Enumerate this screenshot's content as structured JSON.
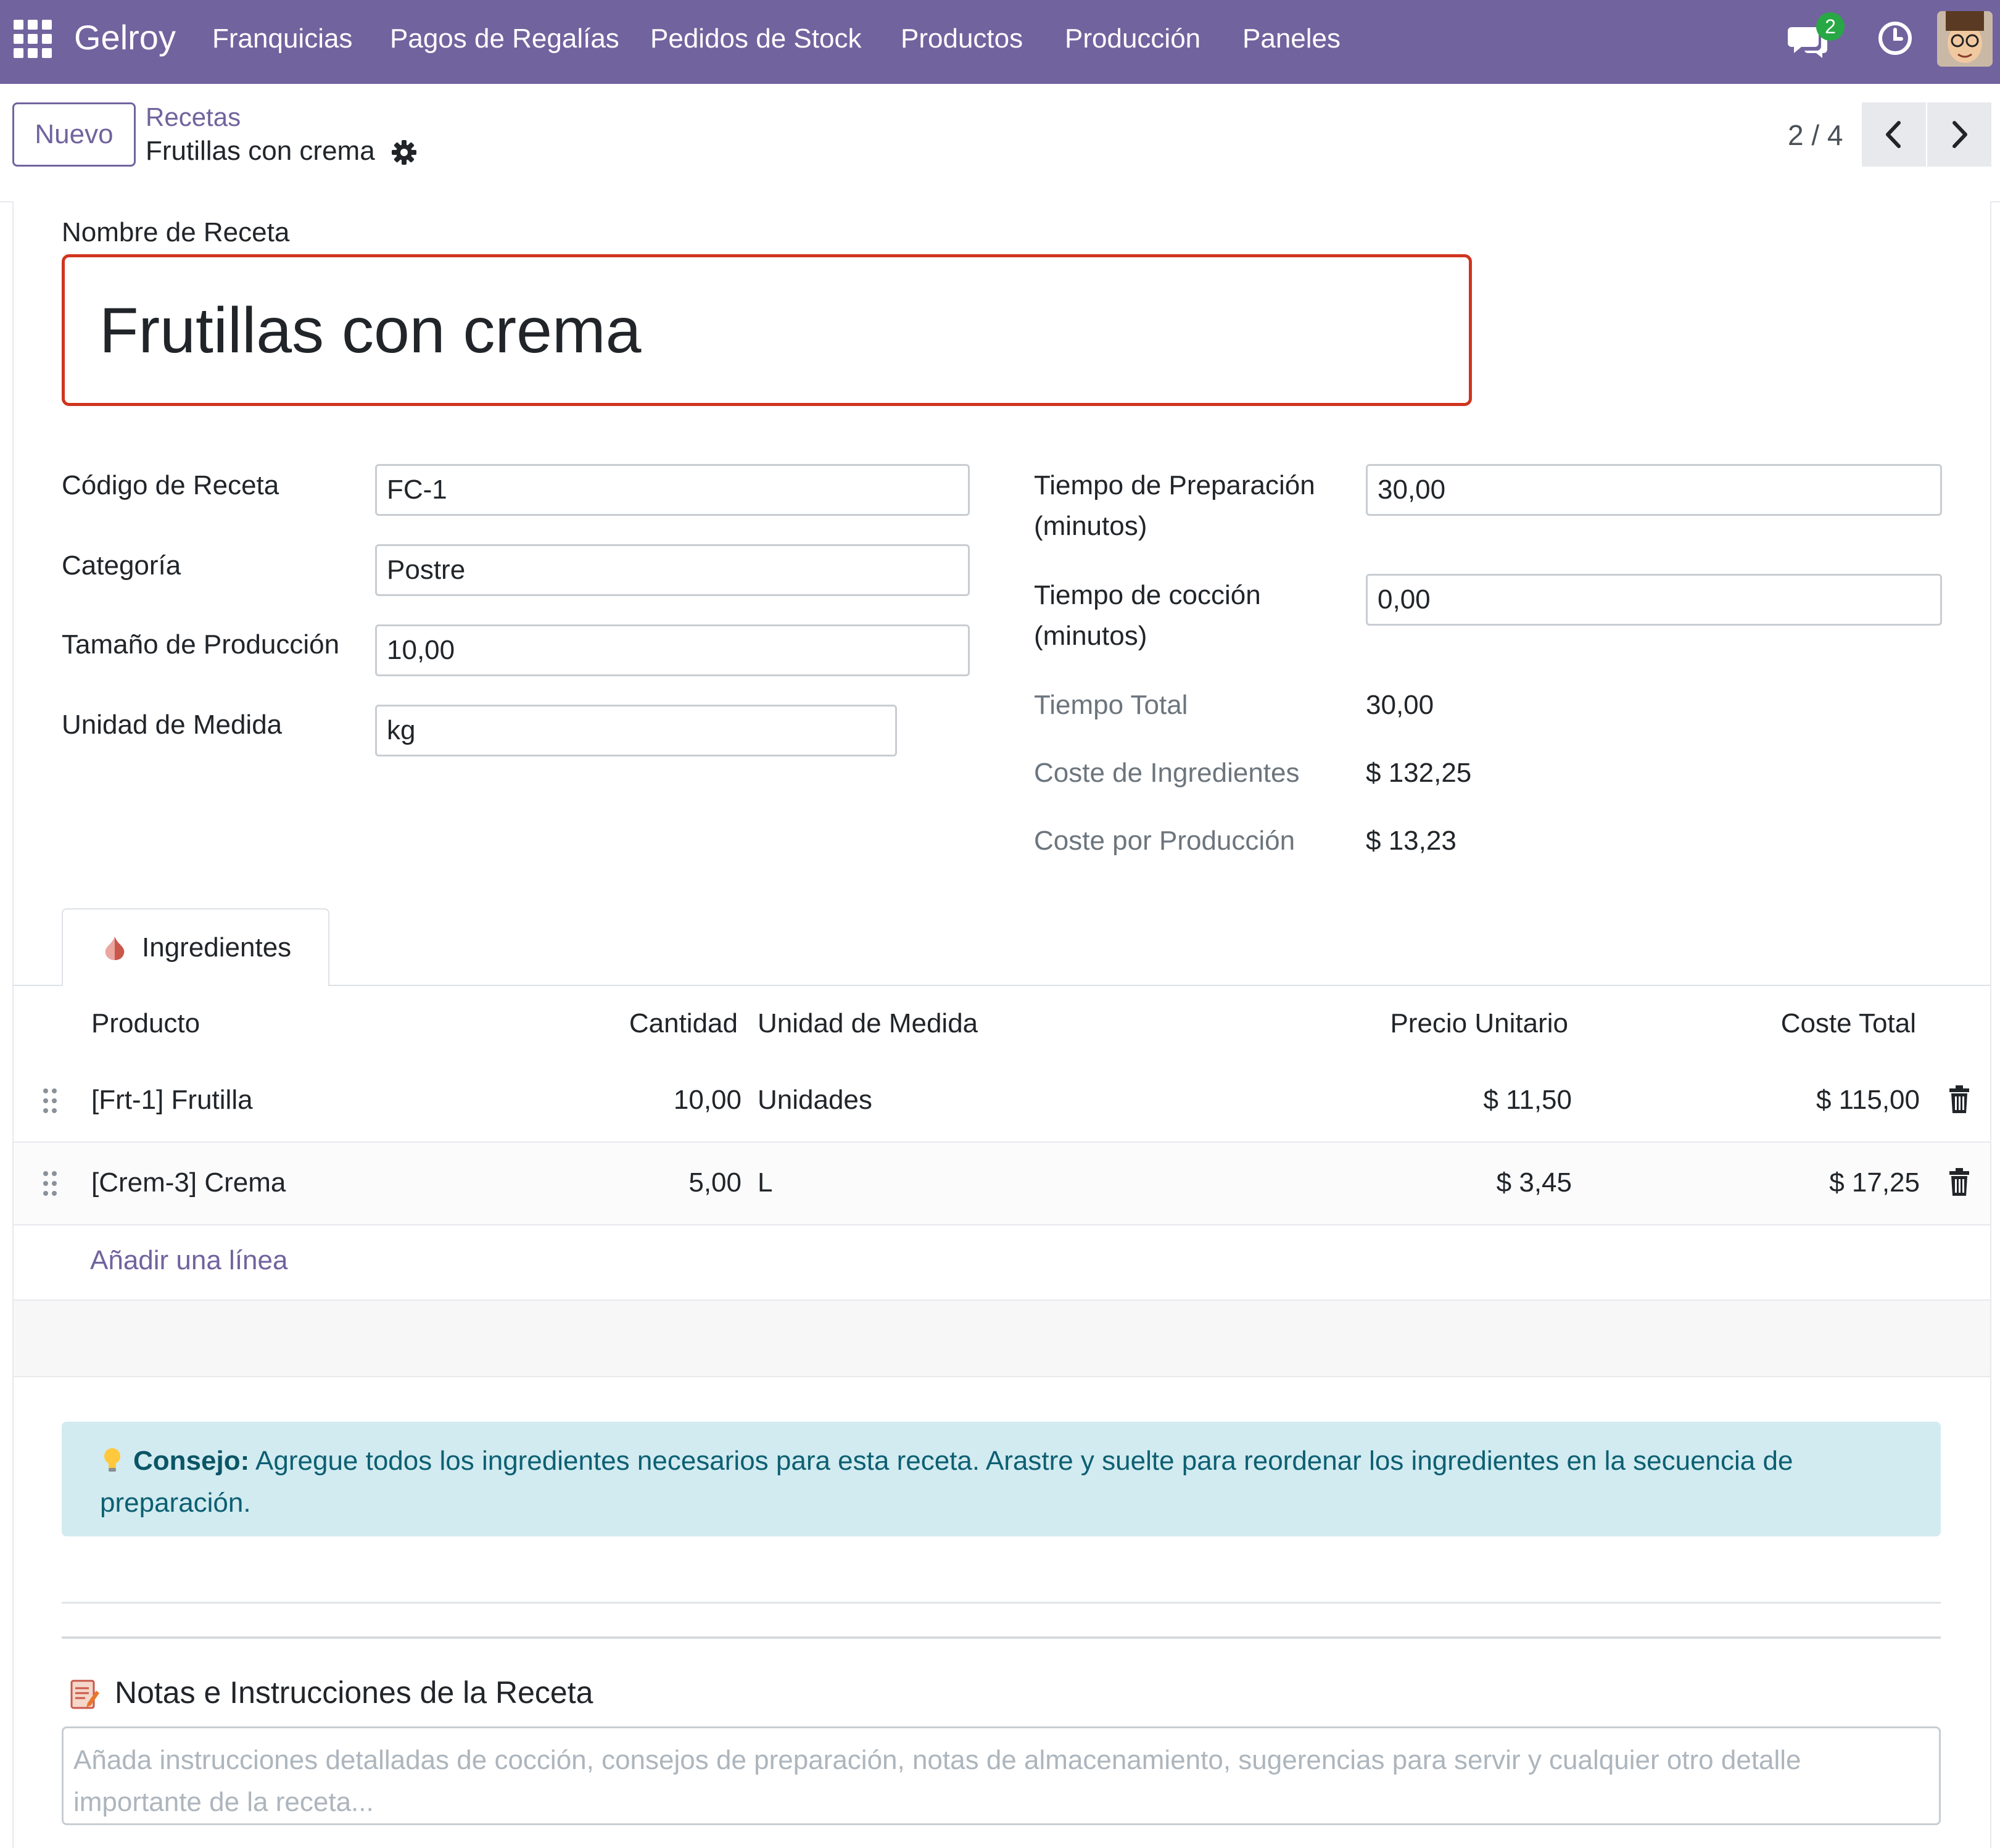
{
  "app": {
    "brand": "Gelroy",
    "menu": [
      "Franquicias",
      "Pagos de Regalías",
      "Pedidos de Stock",
      "Productos",
      "Producción",
      "Paneles"
    ],
    "chat_badge": "2",
    "accent_color": "#71639e"
  },
  "control": {
    "new_button": "Nuevo",
    "breadcrumb_parent": "Recetas",
    "breadcrumb_current": "Frutillas con crema",
    "pager": "2 / 4"
  },
  "form": {
    "name_label": "Nombre de Receta",
    "name_value": "Frutillas con crema",
    "left": [
      {
        "label": "Código de Receta",
        "value": "FC-1"
      },
      {
        "label": "Categoría",
        "value": "Postre"
      },
      {
        "label": "Tamaño de Producción",
        "value": "10,00"
      },
      {
        "label": "Unidad de Medida",
        "value": "kg"
      }
    ],
    "right": {
      "prep_label_1": "Tiempo de Preparación",
      "prep_label_2": "(minutos)",
      "prep_value": "30,00",
      "cook_label_1": "Tiempo de cocción",
      "cook_label_2": "(minutos)",
      "cook_value": "0,00",
      "total_label": "Tiempo Total",
      "total_value": "30,00",
      "ingredient_cost_label": "Coste de Ingredientes",
      "ingredient_cost_value": "$ 132,25",
      "cost_per_prod_label": "Coste por Producción",
      "cost_per_prod_value": "$ 13,23"
    }
  },
  "tab": {
    "label": "Ingredientes",
    "icon": "garlic-icon"
  },
  "table": {
    "headers": [
      "Producto",
      "Cantidad",
      "Unidad de Medida",
      "Precio Unitario",
      "Coste Total"
    ],
    "rows": [
      {
        "product": "[Frt-1] Frutilla",
        "qty": "10,00",
        "uom": "Unidades",
        "unit_price": "$ 11,50",
        "total": "$ 115,00"
      },
      {
        "product": "[Crem-3] Crema",
        "qty": "5,00",
        "uom": "L",
        "unit_price": "$ 3,45",
        "total": "$ 17,25"
      }
    ],
    "add_line": "Añadir una línea"
  },
  "tip": {
    "title": "Consejo:",
    "text": "Agregue todos los ingredientes necesarios para esta receta. Arastre y suelte para reordenar los ingredientes en la secuencia de preparación."
  },
  "notes": {
    "title": "Notas e Instrucciones de la Receta",
    "placeholder": "Añada instrucciones detalladas de cocción, consejos de preparación, notas de almacenamiento, sugerencias para servir y cualquier otro detalle importante de la receta..."
  }
}
